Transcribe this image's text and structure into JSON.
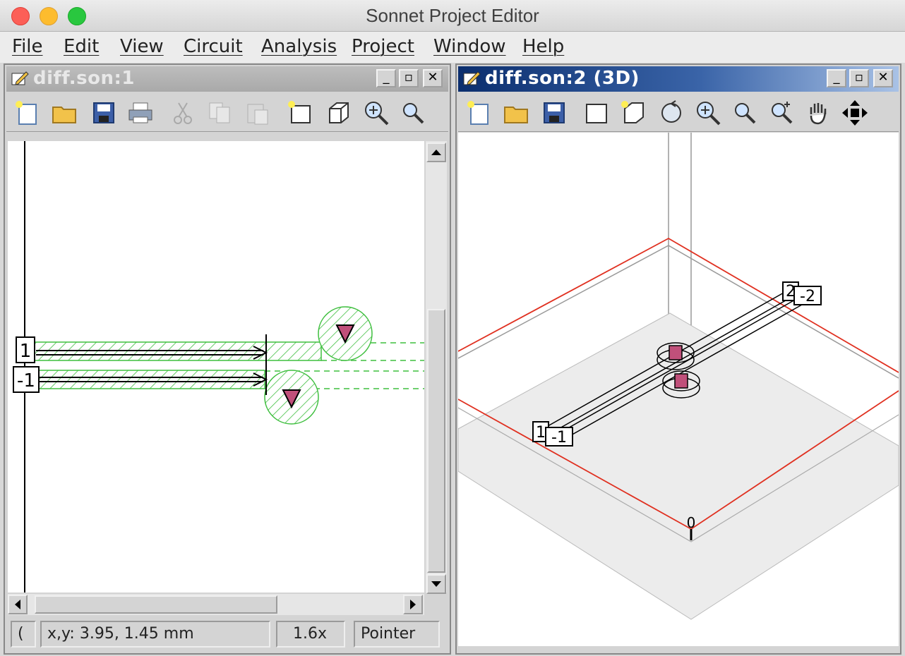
{
  "app": {
    "title": "Sonnet Project Editor"
  },
  "menu": [
    "File",
    "Edit",
    "View",
    "Circuit",
    "Analysis",
    "Project",
    "Window",
    "Help"
  ],
  "window1": {
    "title": "diff.son:1",
    "toolbar_icons": [
      "new-file-icon",
      "open-folder-icon",
      "save-icon",
      "print-icon",
      "cut-icon",
      "copy-icon",
      "paste-icon",
      "new-view-icon",
      "3d-view-icon",
      "zoom-in-icon",
      "zoom-out-icon"
    ],
    "ports": [
      "1",
      "-1"
    ],
    "status": {
      "left": "(",
      "coords": "x,y: 3.95, 1.45 mm",
      "zoom": "1.6x",
      "mode": "Pointer"
    }
  },
  "window2": {
    "title": "diff.son:2 (3D)",
    "toolbar_icons": [
      "new-file-icon",
      "open-folder-icon",
      "save-icon",
      "new-view-icon",
      "2d-view-icon",
      "rotate-icon",
      "zoom-in-icon",
      "zoom-out-icon",
      "zoom-fit-icon",
      "pan-hand-icon",
      "move-arrows-icon"
    ],
    "ports": [
      "1",
      "-1",
      "2",
      "-2",
      "0"
    ]
  },
  "colors": {
    "metal_green": "#3fbf3f",
    "via_pink": "#c0507a",
    "box_red": "#e03020",
    "active_title": "#0b2e6e"
  }
}
